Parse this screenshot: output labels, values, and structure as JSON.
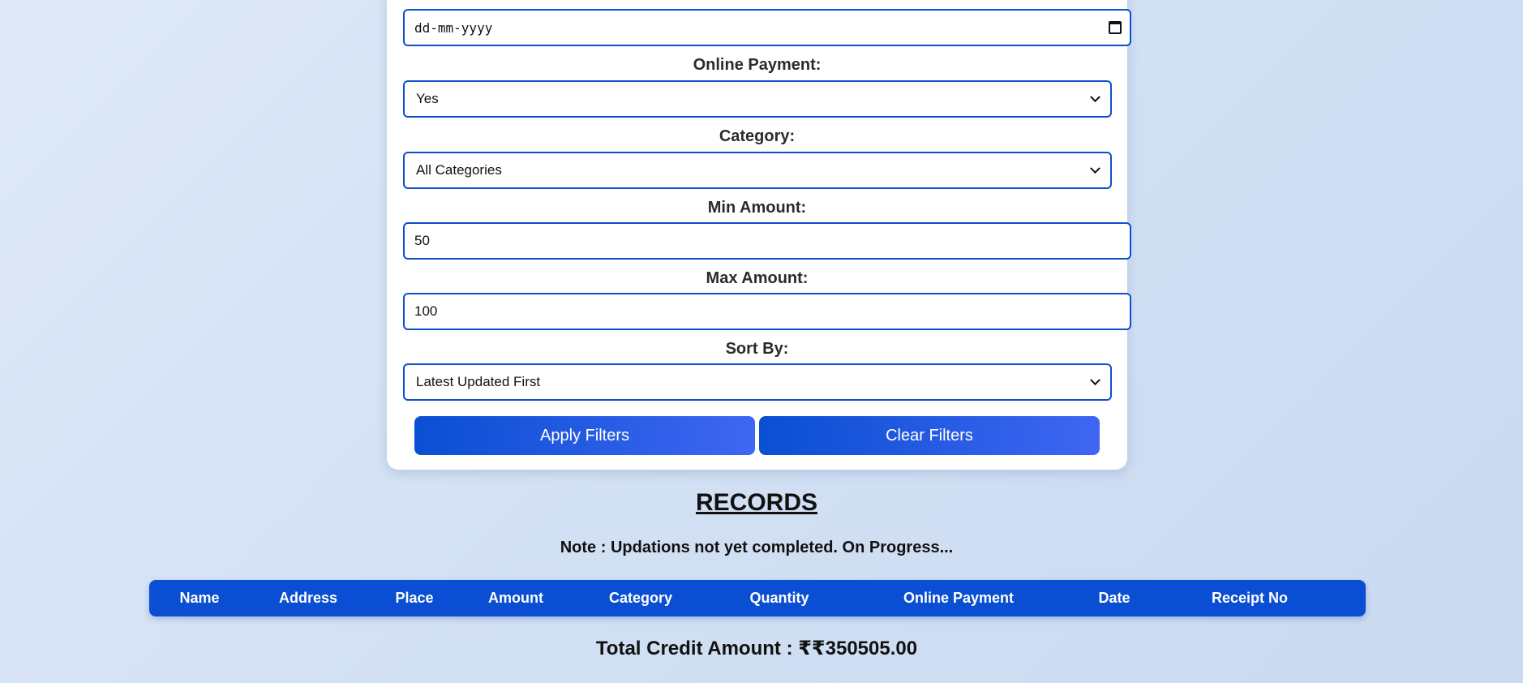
{
  "filters": {
    "date": {
      "placeholder": "dd-mm-yyyy"
    },
    "online_payment": {
      "label": "Online Payment:",
      "selected": "Yes"
    },
    "category": {
      "label": "Category:",
      "selected": "All Categories"
    },
    "min_amount": {
      "label": "Min Amount:",
      "value": "50"
    },
    "max_amount": {
      "label": "Max Amount:",
      "value": "100"
    },
    "sort_by": {
      "label": "Sort By:",
      "selected": "Latest Updated First"
    },
    "apply_label": "Apply Filters",
    "clear_label": "Clear Filters"
  },
  "records": {
    "title": "RECORDS",
    "note": "Note : Updations not yet completed. On Progress...",
    "columns": [
      "Name",
      "Address",
      "Place",
      "Amount",
      "Category",
      "Quantity",
      "Online Payment",
      "Date",
      "Receipt No"
    ],
    "total": "Total Credit Amount : ₹₹350505.00"
  },
  "colors": {
    "accent": "#0a4fd3",
    "accent_gradient_end": "#3f66f2",
    "background": "#d6e3f5"
  },
  "icons": {
    "date_field": "calendar-icon",
    "select_field": "chevron-down-icon"
  }
}
